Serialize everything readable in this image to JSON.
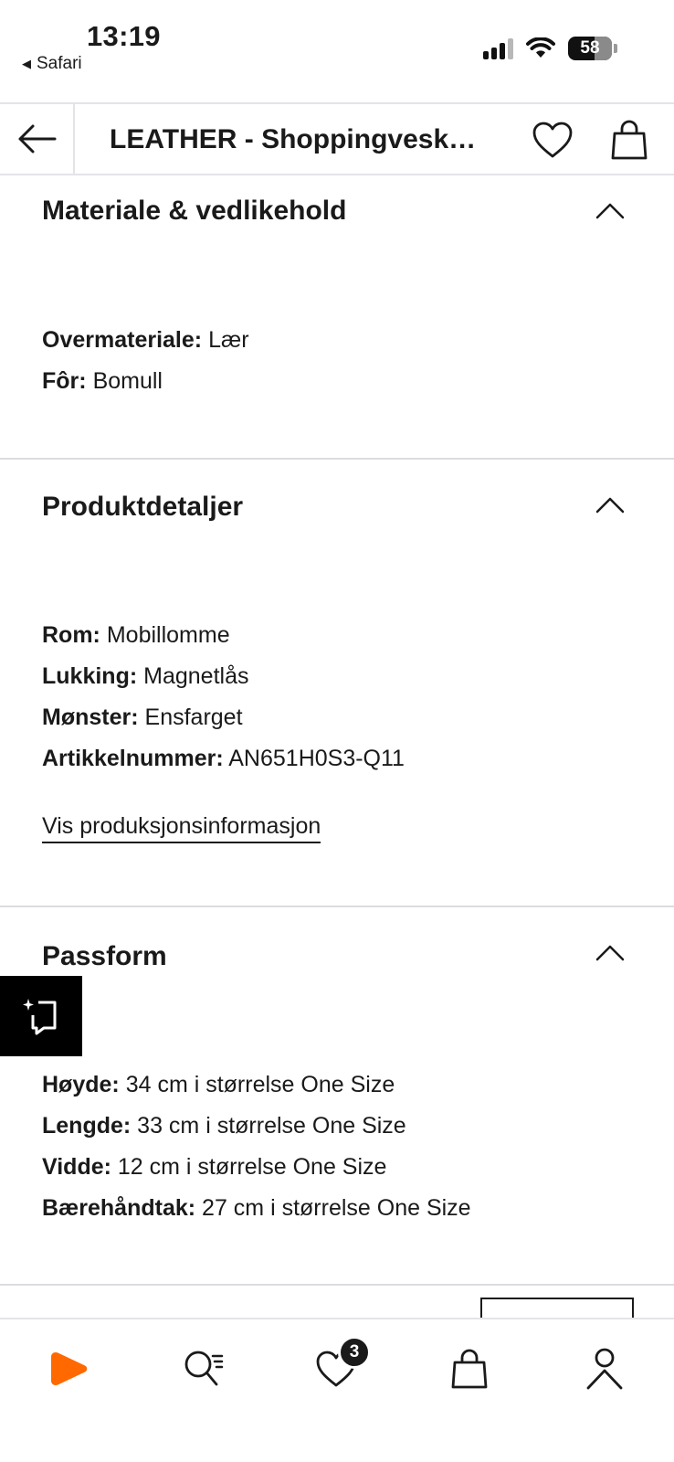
{
  "status_bar": {
    "time": "13:19",
    "back_app": "Safari",
    "battery": "58"
  },
  "header": {
    "title": "LEATHER - Shoppingvesk…",
    "back_icon": "arrow-left-icon",
    "wishlist_icon": "heart-icon",
    "bag_icon": "shopping-bag-icon"
  },
  "sections": {
    "material": {
      "title": "Materiale & vedlikehold",
      "items": [
        {
          "label": "Overmateriale:",
          "value": "Lær"
        },
        {
          "label": "Fôr:",
          "value": "Bomull"
        }
      ]
    },
    "details": {
      "title": "Produktdetaljer",
      "items": [
        {
          "label": "Rom:",
          "value": "Mobillomme"
        },
        {
          "label": "Lukking:",
          "value": "Magnetlås"
        },
        {
          "label": "Mønster:",
          "value": "Ensfarget"
        },
        {
          "label": "Artikkelnummer:",
          "value": "AN651H0S3-Q11"
        }
      ],
      "link": "Vis produksjonsinformasjon"
    },
    "fit": {
      "title": "Passform",
      "items": [
        {
          "label": "Høyde:",
          "value": "34 cm i størrelse One Size"
        },
        {
          "label": "Lengde:",
          "value": "33 cm i størrelse One Size"
        },
        {
          "label": "Vidde:",
          "value": "12 cm i størrelse One Size"
        },
        {
          "label": "Bærehåndtak:",
          "value": "27 cm i størrelse One Size"
        }
      ]
    }
  },
  "bottom_nav": {
    "items": [
      "home-logo-icon",
      "search-icon",
      "wishlist-icon",
      "bag-icon",
      "profile-icon"
    ],
    "wishlist_count": "3"
  },
  "colors": {
    "brand_orange": "#ff6900",
    "text": "#1a1a1a",
    "divider": "#dcdce0"
  }
}
